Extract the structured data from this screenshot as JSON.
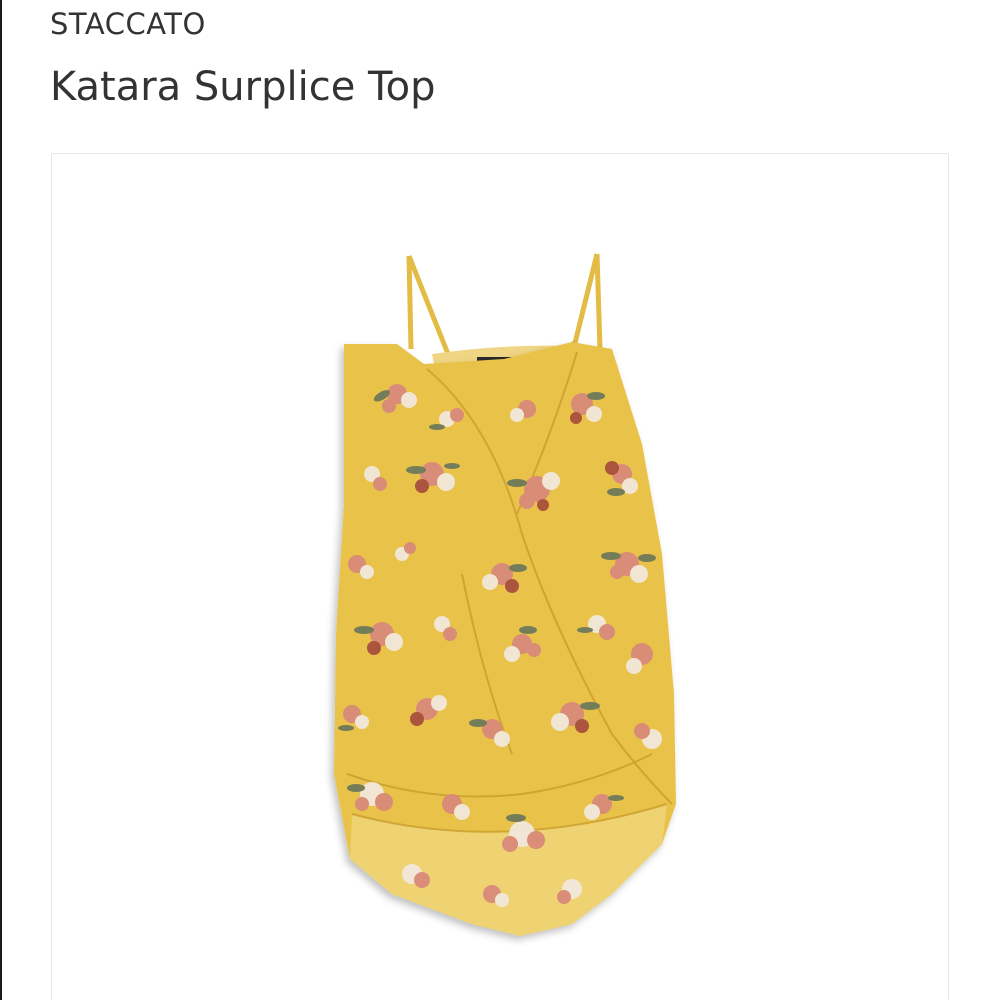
{
  "product": {
    "brand": "STACCATO",
    "title": "Katara Surplice Top"
  },
  "image": {
    "subject": "floral-camisole-icon",
    "background_color": "#ffffff",
    "garment_color": "#e9c348",
    "print_color_primary": "#d98a7a",
    "print_color_secondary": "#f2e8dc",
    "leaf_color": "#6e7a5a"
  }
}
